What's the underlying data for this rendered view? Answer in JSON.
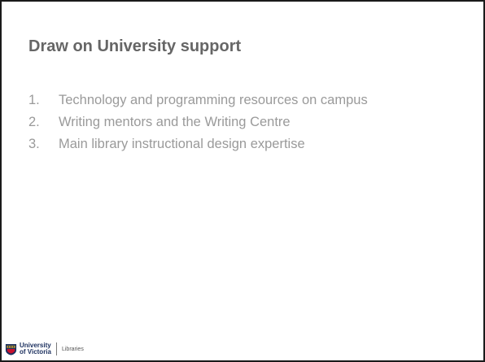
{
  "slide": {
    "title": "Draw on University support",
    "items": [
      {
        "number": "1.",
        "text": "Technology and programming resources on campus"
      },
      {
        "number": "2.",
        "text": "Writing mentors and the Writing Centre"
      },
      {
        "number": "3.",
        "text": "Main library instructional design expertise"
      }
    ]
  },
  "footer": {
    "logo_line1": "University",
    "logo_line2": "of Victoria",
    "unit": "Libraries",
    "logo_icon": "university-crest-icon",
    "logo_colors": {
      "navy": "#1b2f5e",
      "gold": "#c9a227",
      "red": "#c8102e"
    }
  }
}
